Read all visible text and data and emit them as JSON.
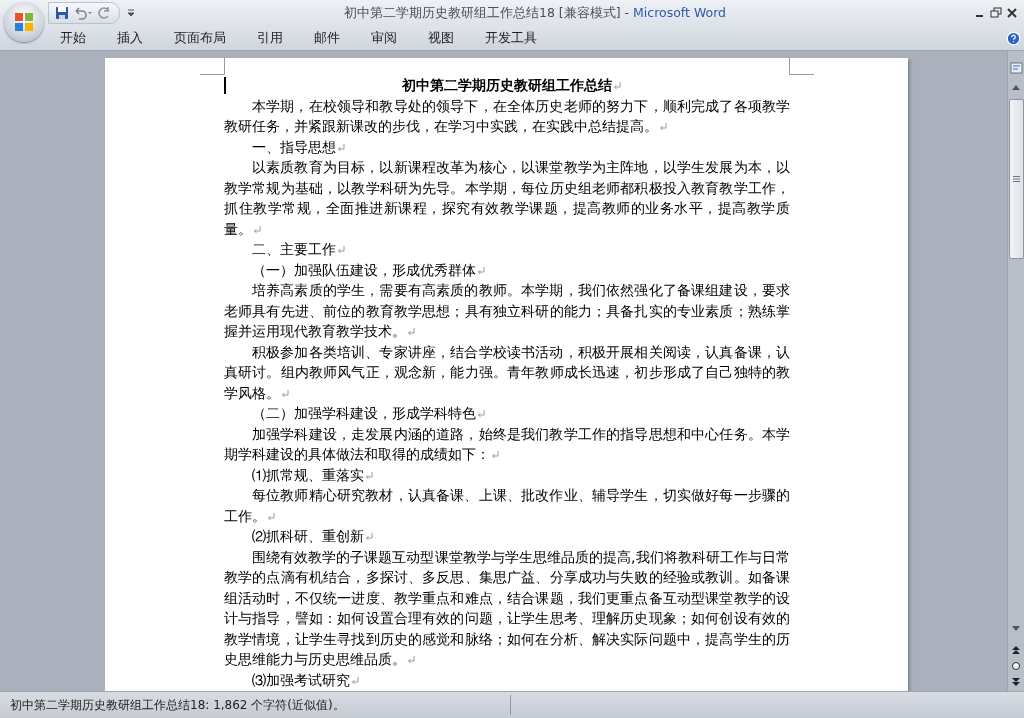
{
  "window": {
    "title": "初中第二学期历史教研组工作总结18 [兼容模式]",
    "separator": "-",
    "app_name": "Microsoft Word"
  },
  "tabs": [
    {
      "label": "开始"
    },
    {
      "label": "插入"
    },
    {
      "label": "页面布局"
    },
    {
      "label": "引用"
    },
    {
      "label": "邮件"
    },
    {
      "label": "审阅"
    },
    {
      "label": "视图"
    },
    {
      "label": "开发工具"
    }
  ],
  "document": {
    "paragraphs": [
      {
        "kind": "title",
        "text": "初中第二学期历史教研组工作总结"
      },
      {
        "kind": "body",
        "text": "本学期，在校领导和教导处的领导下，在全体历史老师的努力下，顺利完成了各项教学教研任务，并紧跟新课改的步伐，在学习中实践，在实践中总结提高。"
      },
      {
        "kind": "body",
        "text": "一、指导思想"
      },
      {
        "kind": "body",
        "text": "以素质教育为目标，以新课程改革为核心，以课堂教学为主阵地，以学生发展为本，以教学常规为基础，以教学科研为先导。本学期，每位历史组老师都积极投入教育教学工作，抓住教学常规，全面推进新课程，探究有效教学课题，提高教师的业务水平，提高教学质量。"
      },
      {
        "kind": "body",
        "text": "二、主要工作"
      },
      {
        "kind": "body",
        "text": "（一）加强队伍建设，形成优秀群体"
      },
      {
        "kind": "body",
        "text": "培养高素质的学生，需要有高素质的教师。本学期，我们依然强化了备课组建设，要求老师具有先进、前位的教育教学思想；具有独立科研的能力；具备扎实的专业素质；熟练掌握并运用现代教育教学技术。"
      },
      {
        "kind": "body",
        "text": "积极参加各类培训、专家讲座，结合学校读书活动，积极开展相关阅读，认真备课，认真研讨。组内教师风气正，观念新，能力强。青年教师成长迅速，初步形成了自己独特的教学风格。"
      },
      {
        "kind": "body",
        "text": "（二）加强学科建设，形成学科特色"
      },
      {
        "kind": "body",
        "text": "加强学科建设，走发展内涵的道路，始终是我们教学工作的指导思想和中心任务。本学期学科建设的具体做法和取得的成绩如下："
      },
      {
        "kind": "body",
        "text": "⑴抓常规、重落实"
      },
      {
        "kind": "body",
        "text": "每位教师精心研究教材，认真备课、上课、批改作业、辅导学生，切实做好每一步骤的工作。"
      },
      {
        "kind": "body",
        "text": "⑵抓科研、重创新"
      },
      {
        "kind": "body",
        "text": "围绕有效教学的子课题互动型课堂教学与学生思维品质的提高,我们将教科研工作与日常教学的点滴有机结合，多探讨、多反思、集思广益、分享成功与失败的经验或教训。如备课组活动时，不仅统一进度、教学重点和难点，结合课题，我们更重点备互动型课堂教学的设计与指导，譬如：如何设置合理有效的问题，让学生思考、理解历史现象；如何创设有效的教学情境，让学生寻找到历史的感觉和脉络；如何在分析、解决实际问题中，提高学生的历史思维能力与历史思维品质。"
      },
      {
        "kind": "body",
        "text": "⑶加强考试研究"
      }
    ]
  },
  "status_bar": {
    "text": "初中第二学期历史教研组工作总结18: 1,862 个字符(近似值)。"
  }
}
